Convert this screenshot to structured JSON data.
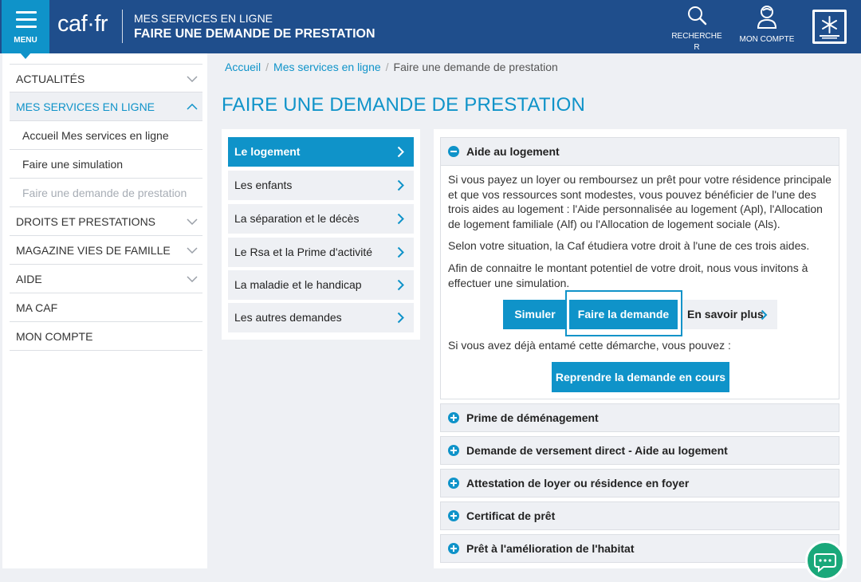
{
  "header": {
    "menu_label": "MENU",
    "logo_text": "caf·fr",
    "subtitle": "MES SERVICES EN LIGNE",
    "title": "FAIRE UNE DEMANDE DE PRESTATION",
    "search_label_line1": "RECHERCHE",
    "search_label_line2": "R",
    "account_label": "MON COMPTE",
    "brand_color": "#1f4e8c",
    "accent_color": "#0f93c9"
  },
  "sidebar": {
    "items": [
      {
        "label": "ACTUALITÉS",
        "expandable": true
      },
      {
        "label": "MES SERVICES EN LIGNE",
        "expandable": true,
        "expanded": true
      },
      {
        "label": "Accueil Mes services en ligne"
      },
      {
        "label": "Faire une simulation"
      },
      {
        "label": "Faire une demande de prestation",
        "current": true
      },
      {
        "label": "DROITS ET PRESTATIONS",
        "expandable": true
      },
      {
        "label": "MAGAZINE VIES DE FAMILLE",
        "expandable": true
      },
      {
        "label": "AIDE",
        "expandable": true
      },
      {
        "label": "MA CAF"
      },
      {
        "label": "MON COMPTE"
      }
    ]
  },
  "breadcrumb": {
    "home": "Accueil",
    "section": "Mes services en ligne",
    "current": "Faire une demande de prestation"
  },
  "page_title": "FAIRE UNE DEMANDE DE PRESTATION",
  "categories": [
    {
      "label": "Le logement",
      "active": true
    },
    {
      "label": "Les enfants"
    },
    {
      "label": "La séparation et le décès"
    },
    {
      "label": "Le Rsa et la Prime d'activité"
    },
    {
      "label": "La maladie et le handicap"
    },
    {
      "label": "Les autres demandes"
    }
  ],
  "accordion": {
    "open_title": "Aide au logement",
    "paragraph1": "Si vous payez un loyer ou remboursez un prêt pour votre résidence principale et que vos ressources sont modestes, vous pouvez bénéficier de l'une des trois aides au logement : l'Aide personnalisée au logement (Apl), l'Allocation de logement familiale (Alf) ou l'Allocation de logement sociale (Als).",
    "paragraph2": "Selon votre situation, la Caf étudiera votre droit à l'une de ces trois aides.",
    "paragraph3": "Afin de connaitre le montant potentiel de votre droit, nous vous invitons à effectuer une simulation.",
    "btn_simulate": "Simuler",
    "btn_request": "Faire la demande",
    "btn_more": "En savoir plus",
    "resume_text": "Si vous avez déjà entamé cette démarche, vous pouvez :",
    "btn_resume": "Reprendre la demande en cours",
    "collapsed": [
      "Prime de déménagement",
      "Demande de versement direct - Aide au logement",
      "Attestation de loyer ou résidence en foyer",
      "Certificat de prêt",
      "Prêt à l'amélioration de l'habitat"
    ]
  }
}
